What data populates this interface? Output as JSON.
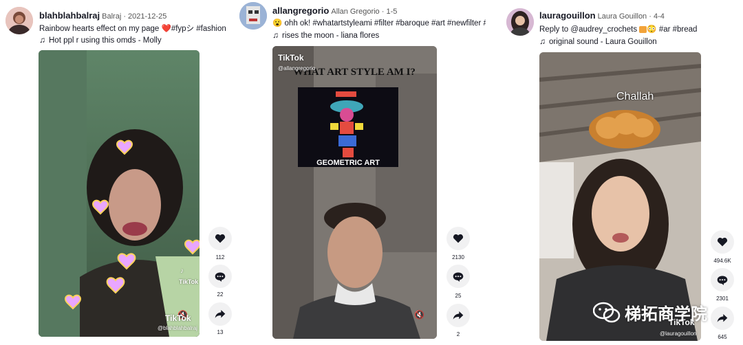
{
  "posts": [
    {
      "username": "blahblahbalraj",
      "nickname": "Balraj",
      "date": "2021-12-25",
      "caption_pre": "Rainbow hearts effect on my page ",
      "caption_emoji": "❤️",
      "caption_post": "#fypシ #fashion",
      "music": "Hot ppl r using this omds - Molly",
      "watermark": "TikTok",
      "watermark_user": "@blahblahbalraj",
      "likes": "112",
      "comments": "22",
      "shares": "13"
    },
    {
      "username": "allangregorio",
      "nickname": "Allan Gregorio",
      "date": "1-5",
      "caption_emoji": "😮",
      "caption": "ohh ok! #whatartstyleami #filter #baroque #art #newfilter #fyp",
      "music": "rises the moon - liana flores",
      "overlay_title": "WHAT ART STYLE AM I?",
      "overlay_label": "GEOMETRIC ART",
      "watermark": "TikTok",
      "watermark_user": "@allangregorio",
      "likes": "2130",
      "comments": "25",
      "shares": "2"
    },
    {
      "username": "lauragouillon",
      "nickname": "Laura Gouillon",
      "date": "4-4",
      "caption_pre": "Reply to ",
      "caption_mention": "@audrey_crochets",
      "caption_post": "#ar #bread",
      "caption_emoji": "😳",
      "music": "original sound - Laura Gouillon",
      "overlay_label": "Challah",
      "watermark": "TikTok",
      "watermark_user": "@lauragouillon",
      "likes": "494.6K",
      "comments": "2301",
      "shares": "645"
    }
  ],
  "brand_watermark": "梯拓商学院",
  "icons": {
    "heart": "heart-icon",
    "comment": "comment-icon",
    "share": "share-icon",
    "music": "music-note-icon",
    "mute": "mute-icon",
    "tiktok": "tiktok-logo-icon"
  }
}
